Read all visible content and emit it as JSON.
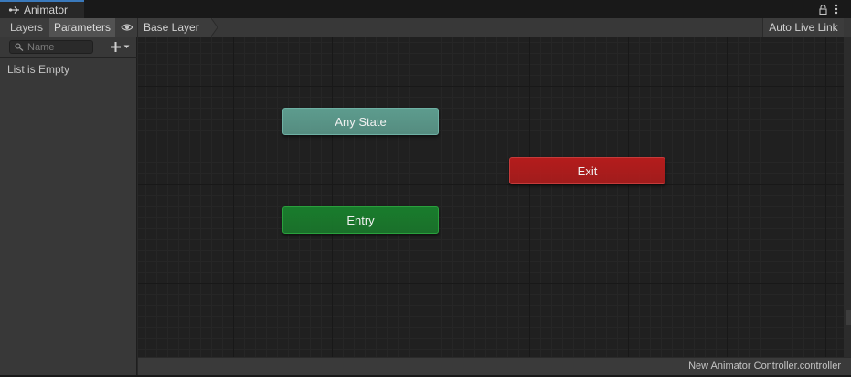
{
  "window": {
    "tab_title": "Animator",
    "tab_icon": "animator-icon",
    "actions": [
      "lock-icon",
      "more-options-icon"
    ]
  },
  "left_panel": {
    "tabs": [
      {
        "label": "Layers"
      },
      {
        "label": "Parameters",
        "active": true
      }
    ],
    "eye_icon": "eye-icon",
    "search": {
      "placeholder": "Name",
      "value": ""
    },
    "add_icon": "plus-icon",
    "empty_text": "List is Empty"
  },
  "breadcrumb": {
    "layer": "Base Layer",
    "auto_live_link": "Auto Live Link"
  },
  "graph": {
    "nodes": [
      {
        "label": "Any State",
        "color": "#5d9c8e"
      },
      {
        "label": "Exit",
        "color": "#b41c1c"
      },
      {
        "label": "Entry",
        "color": "#197c2c"
      }
    ]
  },
  "status_bar": {
    "file": "New Animator Controller.controller"
  }
}
